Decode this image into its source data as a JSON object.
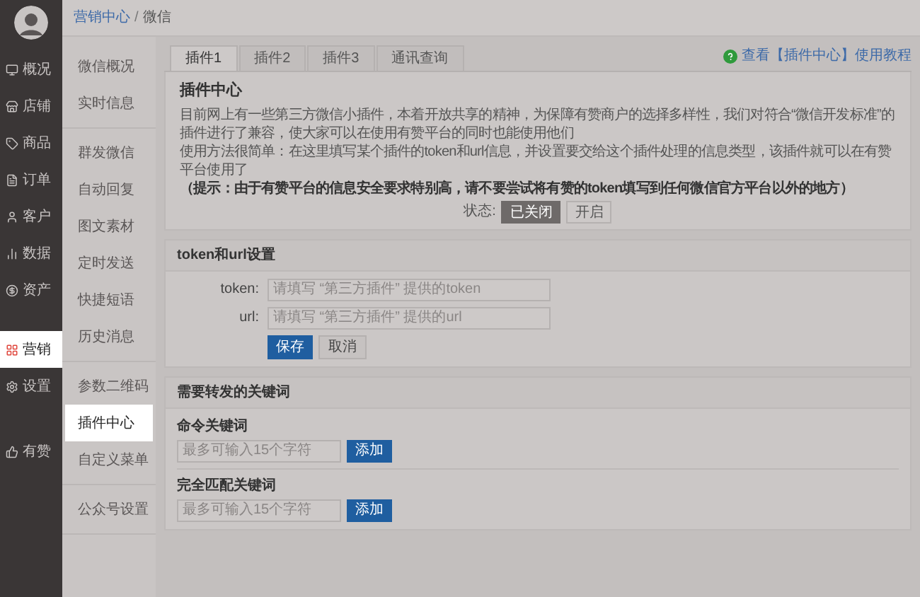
{
  "main_nav": [
    {
      "label": "概况",
      "selected": false
    },
    {
      "label": "店铺",
      "selected": false
    },
    {
      "label": "商品",
      "selected": false
    },
    {
      "label": "订单",
      "selected": false
    },
    {
      "label": "客户",
      "selected": false
    },
    {
      "label": "数据",
      "selected": false
    },
    {
      "label": "资产",
      "selected": false
    },
    {
      "label": "营销",
      "selected": true
    },
    {
      "label": "设置",
      "selected": false
    },
    {
      "label": "有赞",
      "selected": false
    }
  ],
  "breadcrumb": [
    {
      "label": "营销中心",
      "kind": "link"
    },
    {
      "label": "/",
      "kind": "separator"
    },
    {
      "label": "微信",
      "kind": "current"
    }
  ],
  "sub_nav": [
    [
      {
        "label": "微信概况",
        "selected": false
      },
      {
        "label": "实时信息",
        "selected": false
      }
    ],
    [
      {
        "label": "群发微信",
        "selected": false
      },
      {
        "label": "自动回复",
        "selected": false
      },
      {
        "label": "图文素材",
        "selected": false
      },
      {
        "label": "定时发送",
        "selected": false
      },
      {
        "label": "快捷短语",
        "selected": false
      },
      {
        "label": "历史消息",
        "selected": false
      }
    ],
    [
      {
        "label": "参数二维码",
        "selected": false
      },
      {
        "label": "插件中心",
        "selected": true
      },
      {
        "label": "自定义菜单",
        "selected": false
      }
    ],
    [
      {
        "label": "公众号设置",
        "selected": false
      }
    ]
  ],
  "tabs": [
    {
      "label": "插件1",
      "selected": true
    },
    {
      "label": "插件2",
      "selected": false
    },
    {
      "label": "插件3",
      "selected": false
    },
    {
      "label": "通讯查询",
      "selected": false
    }
  ],
  "help_link": "查看【插件中心】使用教程",
  "plugin_center": {
    "title": "插件中心",
    "paragraphs": [
      "目前网上有一些第三方微信小插件，本着开放共享的精神，为保障有赞商户的选择多样性，我们对符合“微信开发标准”的插件进行了兼容，使大家可以在使用有赞平台的同时也能使用他们",
      "使用方法很简单：在这里填写某个插件的token和url信息，并设置要交给这个插件处理的信息类型，该插件就可以在有赞平台使用了"
    ],
    "notice": "（提示：由于有赞平台的信息安全要求特别高，请不要尝试将有赞的token填写到任何微信官方平台以外的地方）",
    "status_label": "状态:",
    "status_options": [
      {
        "label": "已关闭",
        "selected": true
      },
      {
        "label": "开启",
        "selected": false
      }
    ]
  },
  "token_section": {
    "title": "token和url设置",
    "fields": [
      {
        "label": "token:",
        "placeholder": "请填写 “第三方插件” 提供的token"
      },
      {
        "label": "url:",
        "placeholder": "请填写 “第三方插件” 提供的url"
      }
    ],
    "save_button": "保存",
    "cancel_button": "取消"
  },
  "keyword_section": {
    "title": "需要转发的关键词",
    "groups": [
      {
        "title": "命令关键词",
        "placeholder": "最多可输入15个字符",
        "button": "添加"
      },
      {
        "title": "完全匹配关键词",
        "placeholder": "最多可输入15个字符",
        "button": "添加"
      }
    ]
  }
}
